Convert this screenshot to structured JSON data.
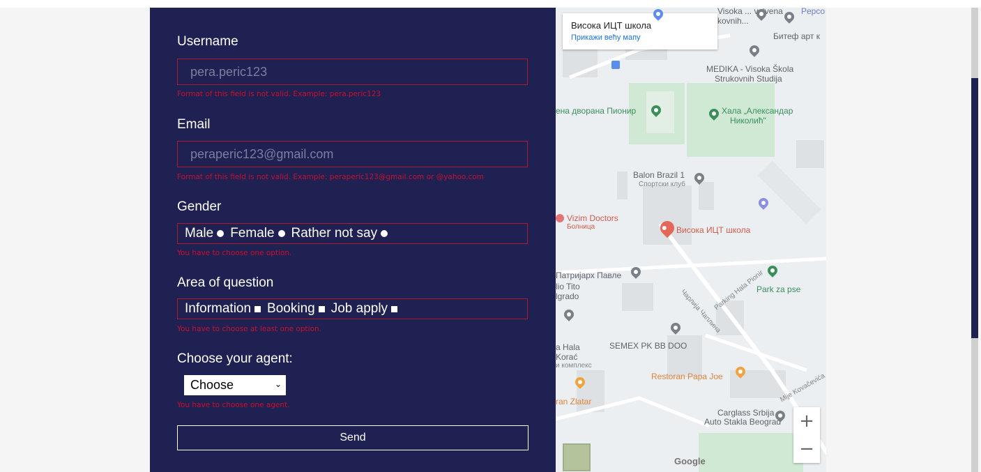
{
  "form": {
    "username": {
      "label": "Username",
      "placeholder": "pera.peric123",
      "error": "Format of this field is not valid. Example: pera.peric123"
    },
    "email": {
      "label": "Email",
      "placeholder": "peraperic123@gmail.com",
      "error": "Format of this field is not valid. Example: peraperic123@gmail.com or @yahoo.com"
    },
    "gender": {
      "label": "Gender",
      "options": [
        "Male",
        "Female",
        "Rather not say"
      ],
      "error": "You have to choose one option."
    },
    "area": {
      "label": "Area of question",
      "options": [
        "Information",
        "Booking",
        "Job apply"
      ],
      "error": "You have to choose at least one option."
    },
    "agent": {
      "label": "Choose your agent:",
      "selected": "Choose",
      "error": "You have to choose one agent."
    },
    "send_label": "Send"
  },
  "map": {
    "info_card": {
      "title": "Висока ИЦТ школа",
      "link": "Прикажи већу мапу"
    },
    "labels": {
      "visoka_top": "Visoka ... vstvena",
      "visoka_top2": "kovnih...",
      "pepco": "Pepco",
      "bitef": "Битеф арт к",
      "medika1": "MEDIKA - Visoka Škola",
      "medika2": "Strukovnih Studija",
      "pionir": "ена дворана Пионир",
      "hala1": "Хала „Александар",
      "hala2": "Николић\"",
      "balon1": "Balon Brazil 1",
      "balon2": "Спортски клуб",
      "vizim1": "Vizim Doctors",
      "vizim2": "Болница",
      "vict": "Висока ИЦТ школа",
      "patrijarh": "Патријарх Павле",
      "tito1": "lio Tito",
      "tito2": "lgrado",
      "park": "Park za pse",
      "parking": "Parking Hala Pionir",
      "carlija": "Чарлија Чаплина",
      "hala_korac1": "a Hala",
      "hala_korac2": "Korać",
      "hala_korac3": "и комплекс",
      "semex": "SEMEX PK BB DOO",
      "papa_joe": "Restoran Papa Joe",
      "kovacevica": "Mije Kovačevića",
      "zlatar": "ran Zlatar",
      "carglass1": "Carglass Srbija -",
      "carglass2": "Auto Stakla Beograd",
      "google": "Google"
    },
    "zoom_in": "+",
    "zoom_out": "−"
  },
  "colors": {
    "panel": "#1e2152",
    "error": "#c8102e",
    "border": "#b01a2a"
  }
}
